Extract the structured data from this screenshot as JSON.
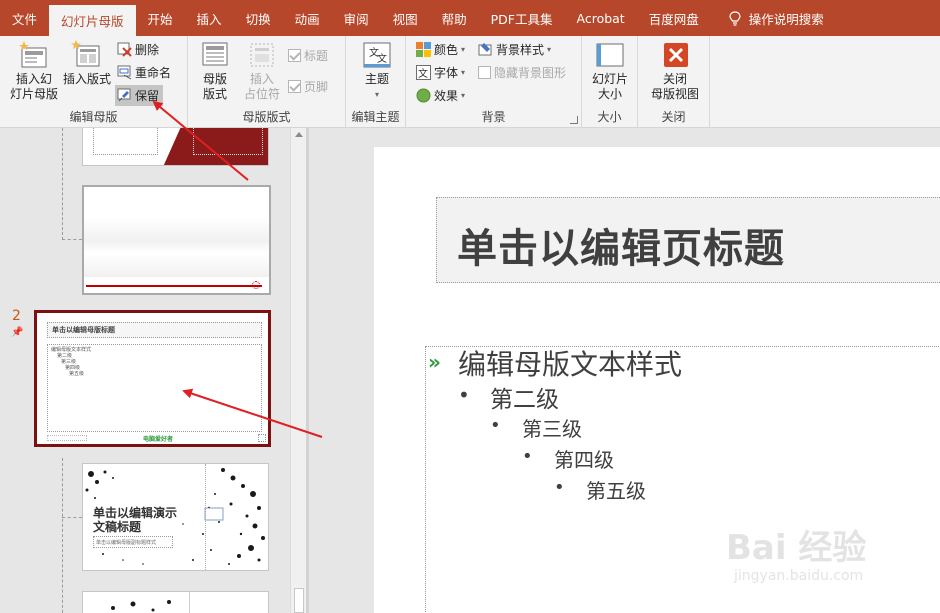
{
  "tabs": [
    {
      "label": "文件",
      "active": false
    },
    {
      "label": "幻灯片母版",
      "active": true
    },
    {
      "label": "开始",
      "active": false
    },
    {
      "label": "插入",
      "active": false
    },
    {
      "label": "切换",
      "active": false
    },
    {
      "label": "动画",
      "active": false
    },
    {
      "label": "审阅",
      "active": false
    },
    {
      "label": "视图",
      "active": false
    },
    {
      "label": "帮助",
      "active": false
    },
    {
      "label": "PDF工具集",
      "active": false
    },
    {
      "label": "Acrobat",
      "active": false
    },
    {
      "label": "百度网盘",
      "active": false
    }
  ],
  "tell_me": "操作说明搜索",
  "ribbon": {
    "edit_master": {
      "label": "编辑母版",
      "insert_slide_master": [
        "插入幻",
        "灯片母版"
      ],
      "insert_layout": [
        "插入版式"
      ],
      "delete": "删除",
      "rename": "重命名",
      "preserve": "保留"
    },
    "master_layout": {
      "label": "母版版式",
      "master_layout_btn": [
        "母版",
        "版式"
      ],
      "insert_placeholder": [
        "插入",
        "占位符"
      ],
      "title_chk": "标题",
      "footer_chk": "页脚"
    },
    "edit_theme": {
      "label": "编辑主题",
      "themes": "主题"
    },
    "background": {
      "label": "背景",
      "colors": "颜色",
      "fonts": "字体",
      "effects": "效果",
      "background_styles": "背景样式",
      "hide_bg_graphics": "隐藏背景图形"
    },
    "size": {
      "label": "大小",
      "slide_size": [
        "幻灯片",
        "大小"
      ]
    },
    "close": {
      "label": "关闭",
      "close_master_view": [
        "关闭",
        "母版视图"
      ]
    }
  },
  "thumbnails": {
    "slide_number": "2",
    "thumb2_title": "单击以编辑母版标题",
    "thumb2_body": [
      "编辑母版文本样式",
      "第二级",
      "第三级",
      "第四级",
      "第五级"
    ],
    "thumb2_logo": "电脑爱好者",
    "thumb3_title": "单击以编辑演示文稿标题",
    "thumb3_subtitle": "单击以编辑母版副标题样式"
  },
  "slide": {
    "title": "单击以编辑页标题",
    "levels": [
      "编辑母版文本样式",
      "第二级",
      "第三级",
      "第四级",
      "第五级"
    ],
    "level1_bullet": "»",
    "sub_bullet": "•"
  },
  "watermark": {
    "logo": "Bai 经验",
    "url": "jingyan.baidu.com"
  },
  "colors": {
    "brand": "#b7472a",
    "annotation": "#e02020",
    "accent_green": "#2e9a3c"
  }
}
